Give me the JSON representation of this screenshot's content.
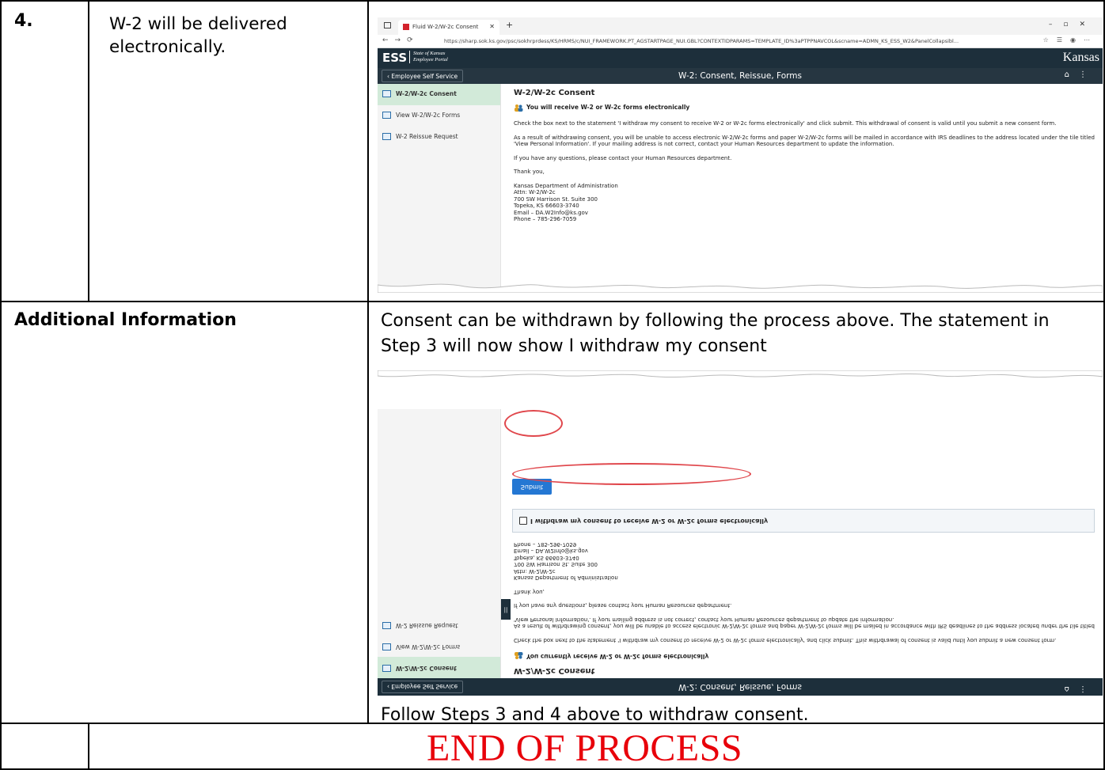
{
  "step": {
    "number": "4.",
    "text": "W-2 will be delivered electronically."
  },
  "browser": {
    "tab_title": "Fluid W-2/W-2c Consent",
    "url": "https://sharp.sok.ks.gov/psc/sokhrprdess/KS/HRMS/c/NUI_FRAMEWORK.PT_AGSTARTPAGE_NUI.GBL?CONTEXTIDPARAMS=TEMPLATE_ID%3aPTPPNAVCOL&scname=ADMN_KS_ESS_W2&PanelCollapsibl..."
  },
  "portal": {
    "logo": "ESS",
    "subtitle_line1": "State of Kansas",
    "subtitle_line2": "Employee Portal",
    "state_brand": "Kansas",
    "back_label": "Employee Self Service",
    "page_title": "W-2: Consent, Reissue, Forms"
  },
  "sidebar": {
    "items": [
      {
        "label": "W-2/W-2c Consent"
      },
      {
        "label": "View W-2/W-2c Forms"
      },
      {
        "label": "W-2 Reissue Request"
      }
    ]
  },
  "consent_page": {
    "heading": "W-2/W-2c Consent",
    "notice": "You will receive W-2 or W-2c forms electronically",
    "para1": "Check the box next to the statement 'I withdraw my consent to receive W-2 or W-2c forms electronically' and click submit.  This withdrawal of consent is valid until you submit a new consent form.",
    "para2": "As a result of withdrawing consent, you will be unable to access electronic W-2/W-2c forms and paper W-2/W-2c forms will be mailed in accordance with IRS deadlines to the address located under the tile titled 'View Personal Information'.  If your mailing address is not correct, contact your Human Resources department to update the information.",
    "para3": "If you have any questions, please contact your Human Resources department.",
    "thanks": "Thank you,",
    "contact": "Kansas Department of Administration\nAttn: W-2/W-2c\n700 SW Harrison St. Suite 300\nTopeka, KS  66603-3740\nEmail – DA.W2Info@ks.gov\nPhone – 785-296-7059"
  },
  "additional": {
    "label": "Additional Information",
    "text": "Consent can be withdrawn by following the process above.  The statement in Step 3 will now show I withdraw my consent",
    "follow": "Follow Steps 3 and 4 above to withdraw consent."
  },
  "withdraw_page": {
    "notice": "You currently receive W-2 or W-2c forms electronically",
    "checkbox_label": "I withdraw my consent to receive W-2 or W-2c forms electronically",
    "submit_label": "Submit"
  },
  "end": {
    "text": "END OF PROCESS"
  },
  "colors": {
    "end_text": "#e8000a",
    "annotation_oval": "#e0474c",
    "submit_button": "#2477d3",
    "header_bar": "#1d2f3b",
    "active_item": "#d2ead9"
  }
}
